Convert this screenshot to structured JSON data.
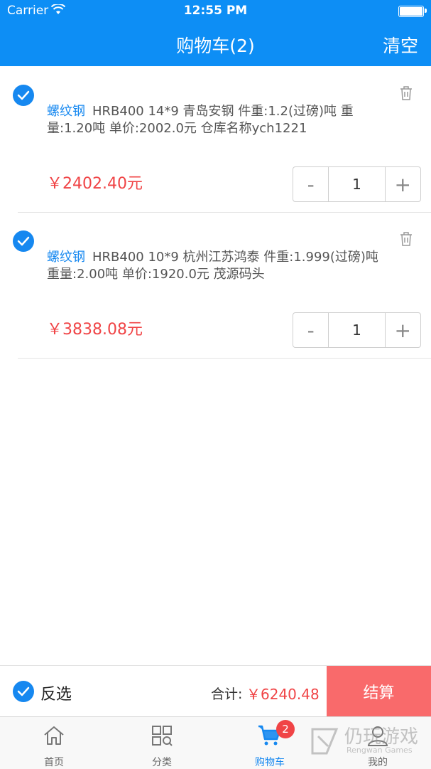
{
  "status_bar": {
    "carrier": "Carrier",
    "time": "12:55 PM"
  },
  "nav": {
    "title": "购物车(2)",
    "clear": "清空"
  },
  "items": [
    {
      "kind": "螺纹钢",
      "desc": "HRB400  14*9  青岛安钢  件重:1.2(过磅)吨  重量:1.20吨  单价:2002.0元  仓库名称ych1221",
      "price": "￥2402.40元",
      "quantity": "1",
      "minus": "-",
      "plus": "+"
    },
    {
      "kind": "螺纹钢",
      "desc": "HRB400  10*9  杭州江苏鸿泰  件重:1.999(过磅)吨  重量:2.00吨  单价:1920.0元  茂源码头",
      "price": "￥3838.08元",
      "quantity": "1",
      "minus": "-",
      "plus": "+"
    }
  ],
  "footer": {
    "invert_label": "反选",
    "total_label": "合计:",
    "total_value": "￥6240.48",
    "checkout": "结算"
  },
  "tabbar": {
    "tabs": [
      {
        "label": "首页",
        "icon": "home-icon"
      },
      {
        "label": "分类",
        "icon": "category-icon"
      },
      {
        "label": "购物车",
        "icon": "cart-icon"
      },
      {
        "label": "我的",
        "icon": "user-icon"
      }
    ],
    "active_tab": "购物车",
    "cart_badge": "2"
  },
  "watermark": {
    "text": "仍玩游戏",
    "sub": "Rengwan Games"
  },
  "colors": {
    "primary": "#0d8ef5",
    "accent_red": "#f04446",
    "checkout_bg": "#f96a6b"
  }
}
